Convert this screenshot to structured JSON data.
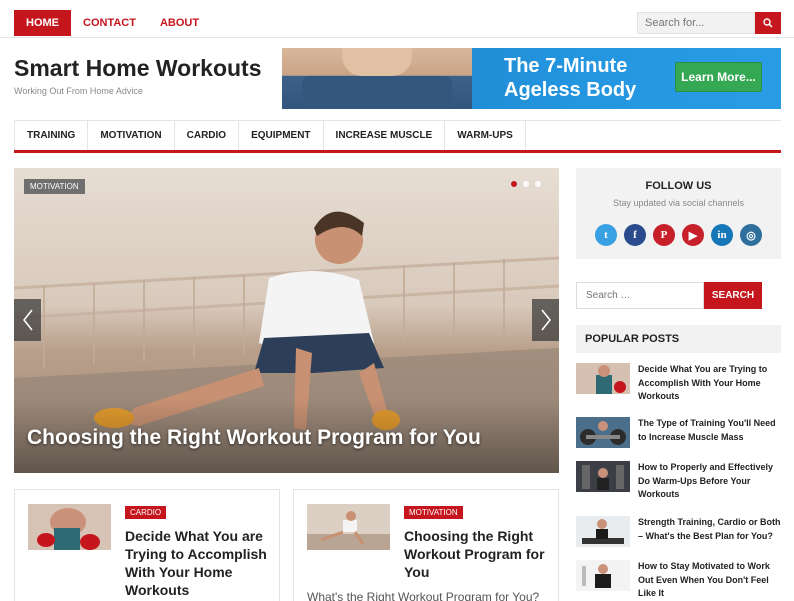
{
  "top_nav": {
    "items": [
      {
        "label": "HOME",
        "active": true
      },
      {
        "label": "CONTACT",
        "active": false
      },
      {
        "label": "ABOUT",
        "active": false
      }
    ],
    "search_placeholder": "Search for..."
  },
  "header": {
    "site_title": "Smart Home Workouts",
    "tagline": "Working Out From Home Advice",
    "banner": {
      "headline_line1": "The 7-Minute",
      "headline_line2": "Ageless Body",
      "cta": "Learn More..."
    }
  },
  "main_nav": {
    "items": [
      "TRAINING",
      "MOTIVATION",
      "CARDIO",
      "EQUIPMENT",
      "INCREASE MUSCLE",
      "WARM-UPS"
    ]
  },
  "slider": {
    "category": "MOTIVATION",
    "title": "Choosing the Right Workout Program for You",
    "active_dot": 0,
    "dot_count": 3
  },
  "cards": [
    {
      "category": "CARDIO",
      "title": "Decide What You are Trying to Accomplish With Your Home Workouts",
      "excerpt": ""
    },
    {
      "category": "MOTIVATION",
      "title": "Choosing the Right Workout Program for You",
      "excerpt": "What's the Right Workout Program for You?"
    }
  ],
  "sidebar": {
    "follow_title": "FOLLOW US",
    "follow_subtitle": "Stay updated via social channels",
    "social": [
      {
        "name": "twitter-icon",
        "glyph": "t",
        "color": "#3aa0e4"
      },
      {
        "name": "facebook-icon",
        "glyph": "f",
        "color": "#2a4b8d"
      },
      {
        "name": "pinterest-icon",
        "glyph": "P",
        "color": "#c8202a"
      },
      {
        "name": "youtube-icon",
        "glyph": "▶",
        "color": "#c8202a"
      },
      {
        "name": "linkedin-icon",
        "glyph": "in",
        "color": "#1577b5"
      },
      {
        "name": "instagram-icon",
        "glyph": "◎",
        "color": "#2f6f9e"
      }
    ],
    "search_placeholder": "Search …",
    "search_button": "SEARCH",
    "popular_title": "POPULAR POSTS",
    "popular_posts": [
      "Decide What You are Trying to Accomplish With Your Home Workouts",
      "The Type of Training You'll Need to Increase Muscle Mass",
      "How to Properly and Effectively Do Warm-Ups Before Your Workouts",
      "Strength Training, Cardio or Both – What's the Best Plan for You?",
      "How to Stay Motivated to Work Out Even When You Don't Feel Like It"
    ]
  },
  "colors": {
    "accent": "#c4161c",
    "banner_blue": "#2396df",
    "cta_green": "#34a853"
  }
}
